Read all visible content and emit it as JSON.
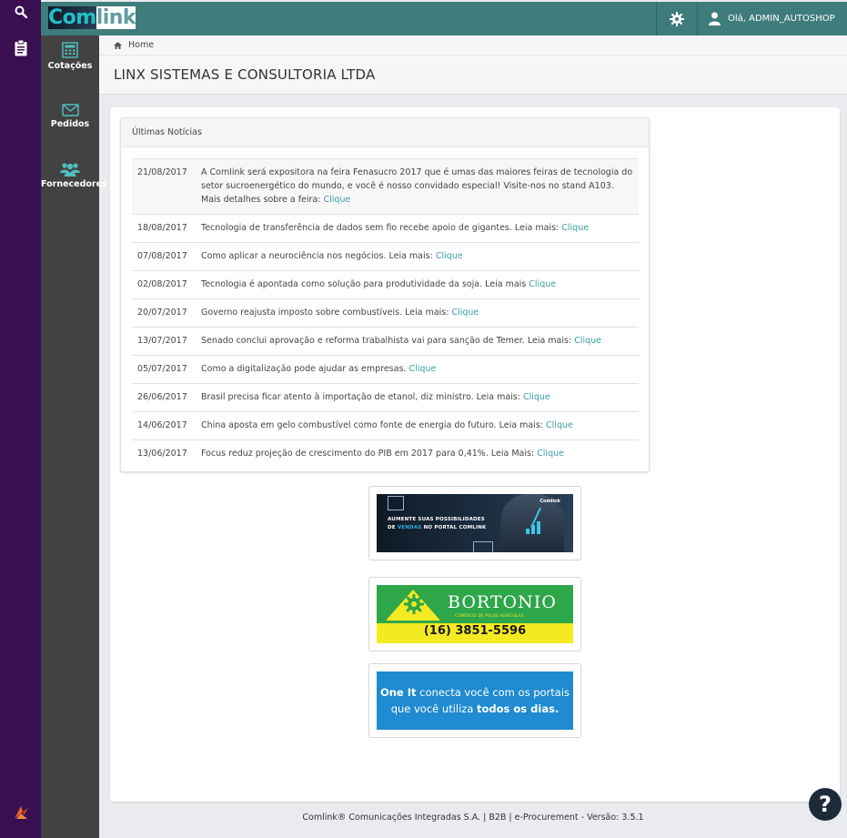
{
  "brand": {
    "part1": "Com",
    "part2": "link"
  },
  "header": {
    "user_greeting": "Olá, ADMIN_AUTOSHOP"
  },
  "sidebar": {
    "items": [
      {
        "label": "Cotações",
        "icon": "calculator-icon"
      },
      {
        "label": "Pedidos",
        "icon": "envelope-icon"
      },
      {
        "label": "Fornecedores",
        "icon": "users-icon"
      }
    ]
  },
  "breadcrumb": {
    "home": "Home"
  },
  "page": {
    "title": "LINX SISTEMAS E CONSULTORIA LTDA"
  },
  "news": {
    "heading": "Últimas Notícias",
    "items": [
      {
        "date": "21/08/2017",
        "text": "A Comlink será expositora na feira Fenasucro 2017 que é umas das maiores feiras de tecnologia do setor sucroenergético do mundo, e você é nosso convidado especial! Visite-nos no stand A103. Mais detalhes sobre a feira: ",
        "link": "Clique"
      },
      {
        "date": "18/08/2017",
        "text": "Tecnologia de transferência de dados sem fio recebe apoio de gigantes. Leia mais: ",
        "link": "Clique"
      },
      {
        "date": "07/08/2017",
        "text": "Como aplicar a neurociência nos negócios. Leia mais: ",
        "link": "Clique"
      },
      {
        "date": "02/08/2017",
        "text": "Tecnologia é apontada como solução para produtividade da soja. Leia mais ",
        "link": "Clique"
      },
      {
        "date": "20/07/2017",
        "text": "Governo reajusta imposto sobre combustíveis. Leia mais: ",
        "link": "Clique"
      },
      {
        "date": "13/07/2017",
        "text": "Senado conclui aprovação e reforma trabalhista vai para sanção de Temer. Leia mais: ",
        "link": "Clique"
      },
      {
        "date": "05/07/2017",
        "text": "Como a digitalização pode ajudar as empresas. ",
        "link": "Clique"
      },
      {
        "date": "26/06/2017",
        "text": "Brasil precisa ficar atento à importação de etanol, diz ministro. Leia mais: ",
        "link": "Clique"
      },
      {
        "date": "14/06/2017",
        "text": "China aposta em gelo combustível como fonte de energia do futuro. Leia mais: ",
        "link": "Clique"
      },
      {
        "date": "13/06/2017",
        "text": "Focus reduz projeção de crescimento do PIB em 2017 para 0,41%. Leia Mais: ",
        "link": "Clique"
      }
    ]
  },
  "banners": {
    "b1": {
      "line1": "AUMENTE SUAS POSSIBILIDADES",
      "line2a": "DE ",
      "line2b": "VENDAS",
      "line2c": " NO PORTAL COMLINK",
      "logo": "Comlink"
    },
    "b2": {
      "name": "BORTONIO",
      "sub": "COMÉRCIO DE PEÇAS AGRÍCOLAS",
      "phone": "(16) 3851-5596"
    },
    "b3": {
      "l1a": "One It",
      "l1b": " conecta você com os portais",
      "l2a": "que você utiliza ",
      "l2b": "todos os dias."
    }
  },
  "footer": {
    "text": "Comlink® Comunicações Integradas S.A. | B2B | e-Procurement - Versão: 3.5.1"
  },
  "help": {
    "label": "?"
  },
  "colors": {
    "rail": "#3a0f52",
    "header": "#3f7c7c",
    "sidebar": "#424242",
    "link": "#3a9e9e",
    "help": "#1d2a3a"
  }
}
